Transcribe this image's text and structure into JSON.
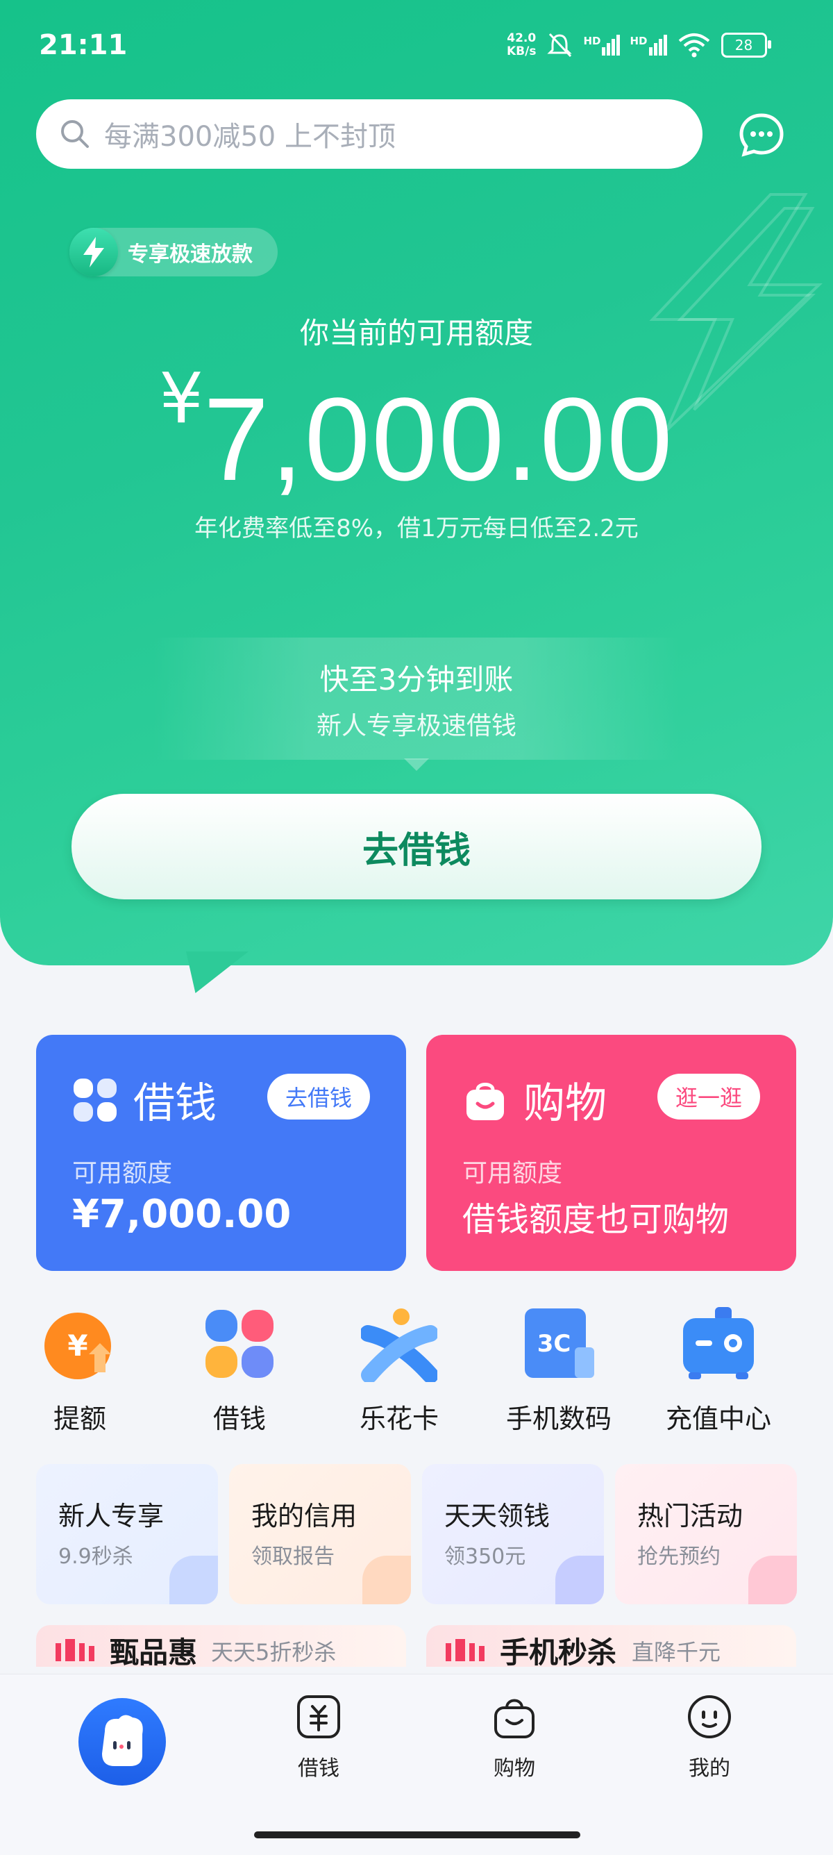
{
  "status_bar": {
    "time": "21:11",
    "net_speed_value": "42.0",
    "net_speed_unit": "KB/s",
    "signal_label_1": "HD",
    "signal_label_2": "HD",
    "battery": "28"
  },
  "search": {
    "placeholder": "每满300减50 上不封顶"
  },
  "hero": {
    "badge": "专享极速放款",
    "credit_title": "你当前的可用额度",
    "currency": "¥",
    "amount": "7,000.00",
    "rate_text": "年化费率低至8%，借1万元每日低至2.2元",
    "speed_title": "快至3分钟到账",
    "speed_sub": "新人专享极速借钱",
    "borrow_button": "去借钱"
  },
  "cards": {
    "loan": {
      "title": "借钱",
      "pill": "去借钱",
      "label": "可用额度",
      "value": "¥7,000.00"
    },
    "shop": {
      "title": "购物",
      "pill": "逛一逛",
      "label": "可用额度",
      "value": "借钱额度也可购物"
    }
  },
  "grid": [
    {
      "label": "提额",
      "icon": "raise-limit-icon"
    },
    {
      "label": "借钱",
      "icon": "loan-clover-icon"
    },
    {
      "label": "乐花卡",
      "icon": "lehua-card-icon"
    },
    {
      "label": "手机数码",
      "icon": "digital-3c-icon"
    },
    {
      "label": "充值中心",
      "icon": "recharge-icon"
    }
  ],
  "tiles": [
    {
      "title": "新人专享",
      "sub": "9.9秒杀"
    },
    {
      "title": "我的信用",
      "sub": "领取报告"
    },
    {
      "title": "天天领钱",
      "sub": "领350元"
    },
    {
      "title": "热门活动",
      "sub": "抢先预约"
    }
  ],
  "banners": {
    "left": {
      "title": "甄品惠",
      "sub": "天天5折秒杀"
    },
    "right": {
      "title": "手机秒杀",
      "sub": "直降千元"
    }
  },
  "tabbar": {
    "tabs": [
      {
        "label": "借钱"
      },
      {
        "label": "购物"
      },
      {
        "label": "我的"
      }
    ]
  },
  "colors": {
    "hero_green": "#1fc690",
    "loan_blue": "#4379f7",
    "shop_pink": "#fb4a7f",
    "button_text": "#0d8a5f"
  }
}
